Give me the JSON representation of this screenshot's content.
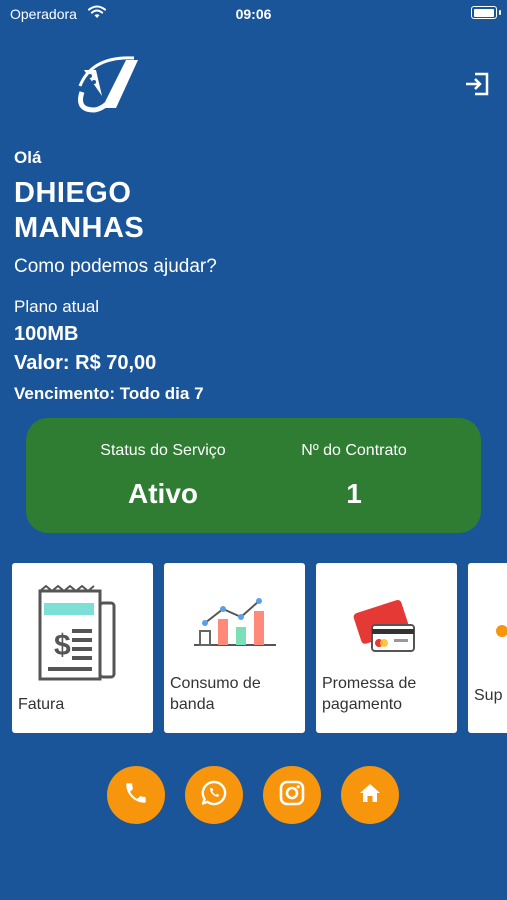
{
  "status_bar": {
    "carrier": "Operadora",
    "time": "09:06"
  },
  "header": {
    "logo_icon": "company-logo-icon",
    "logout_icon": "logout-icon"
  },
  "user": {
    "greeting": "Olá",
    "first_name": "DHIEGO",
    "last_name": "MANHAS",
    "help_text": "Como podemos ajudar?"
  },
  "plan": {
    "label": "Plano atual",
    "speed": "100MB",
    "value": "Valor: R$ 70,00",
    "due": "Vencimento: Todo dia 7"
  },
  "status_card": {
    "color": "#2e7d32",
    "service_label": "Status do Serviço",
    "service_value": "Ativo",
    "contract_label": "Nº do Contrato",
    "contract_value": "1"
  },
  "menu": [
    {
      "label": "Fatura",
      "icon": "invoice-icon"
    },
    {
      "label_line1": "Consumo de",
      "label_line2": "banda",
      "icon": "bandwidth-chart-icon"
    },
    {
      "label_line1": "Promessa de",
      "label_line2": "pagamento",
      "icon": "credit-card-icon"
    },
    {
      "label": "Sup",
      "icon": "support-icon"
    }
  ],
  "bottom_actions": [
    {
      "icon": "phone-icon"
    },
    {
      "icon": "whatsapp-icon"
    },
    {
      "icon": "instagram-icon"
    },
    {
      "icon": "home-icon"
    }
  ],
  "colors": {
    "background": "#1a5599",
    "accent": "#f7950d",
    "status_green": "#2e7d32"
  }
}
